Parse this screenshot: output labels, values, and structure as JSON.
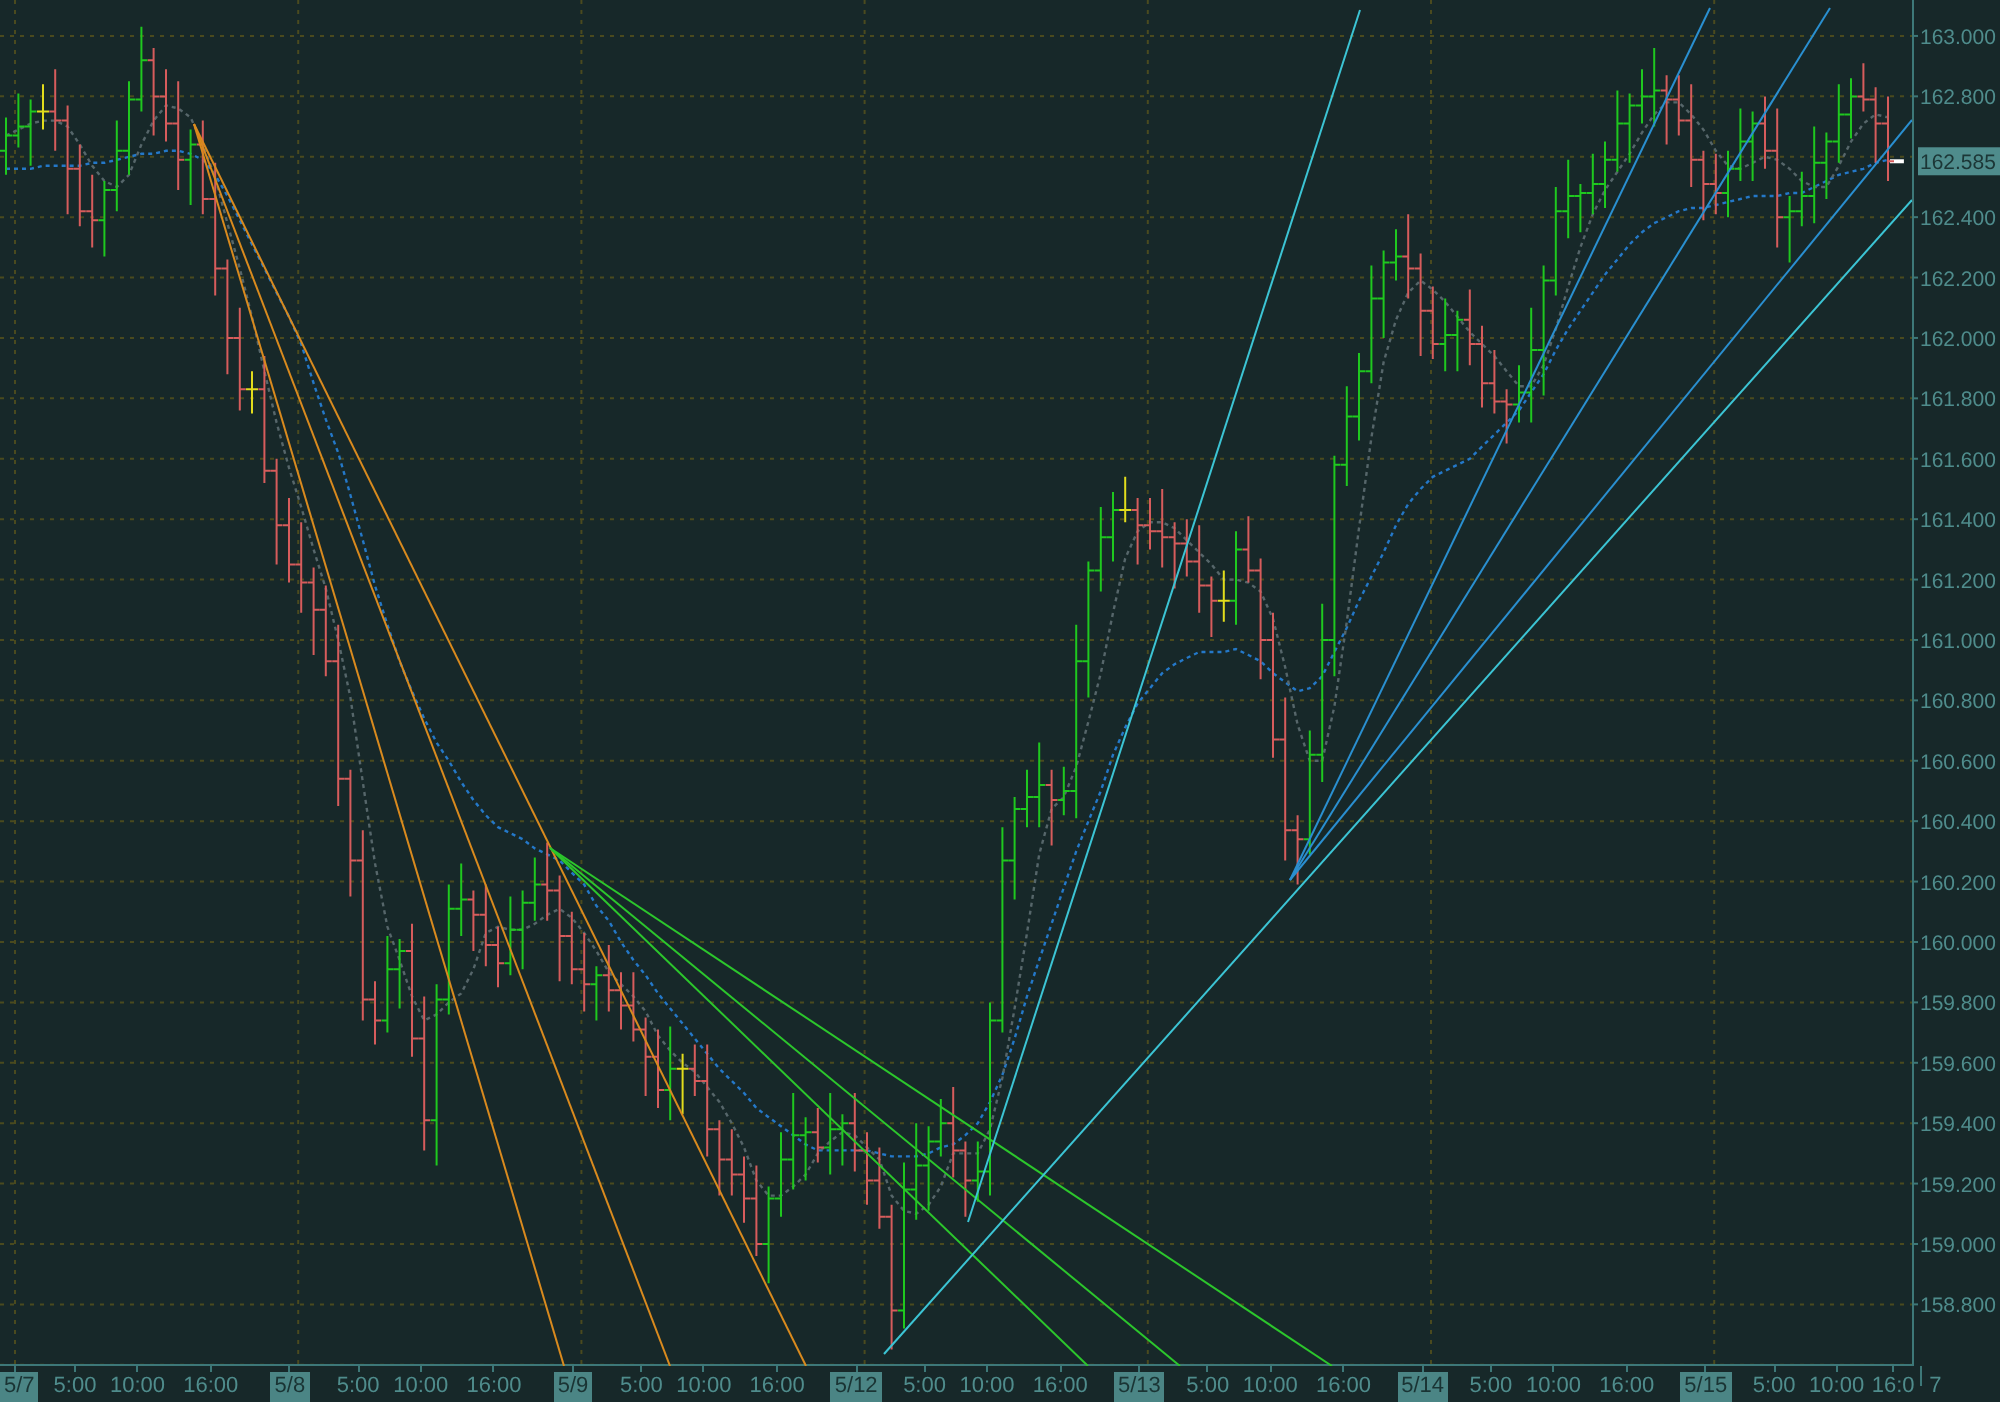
{
  "chart": {
    "chart_data": {
      "type": "line",
      "grid": true,
      "ylim": [
        158.596,
        163.119
      ],
      "yticks": [
        {
          "value": 163.0,
          "label": "163.000"
        },
        {
          "value": 162.8,
          "label": "162.800"
        },
        {
          "value": 162.4,
          "label": "162.400"
        },
        {
          "value": 162.2,
          "label": "162.200"
        },
        {
          "value": 162.0,
          "label": "162.000"
        },
        {
          "value": 161.8,
          "label": "161.800"
        },
        {
          "value": 161.6,
          "label": "161.600"
        },
        {
          "value": 161.4,
          "label": "161.400"
        },
        {
          "value": 161.2,
          "label": "161.200"
        },
        {
          "value": 161.0,
          "label": "161.000"
        },
        {
          "value": 160.8,
          "label": "160.800"
        },
        {
          "value": 160.6,
          "label": "160.600"
        },
        {
          "value": 160.4,
          "label": "160.400"
        },
        {
          "value": 160.2,
          "label": "160.200"
        },
        {
          "value": 160.0,
          "label": "160.000"
        },
        {
          "value": 159.8,
          "label": "159.800"
        },
        {
          "value": 159.6,
          "label": "159.600"
        },
        {
          "value": 159.4,
          "label": "159.400"
        },
        {
          "value": 159.2,
          "label": "159.200"
        },
        {
          "value": 159.0,
          "label": "159.000"
        },
        {
          "value": 158.8,
          "label": "158.800"
        }
      ],
      "series": [
        {
          "color": "#2478c8",
          "line_style": "dashed",
          "values": [
            162.56,
            162.56,
            162.56,
            162.57,
            162.57,
            162.57,
            162.57,
            162.58,
            162.58,
            162.59,
            162.6,
            162.61,
            162.61,
            162.62,
            162.62,
            162.61,
            162.59,
            162.54,
            162.47,
            162.39,
            162.31,
            162.23,
            162.15,
            162.07,
            161.98,
            161.85,
            161.73,
            161.62,
            161.48,
            161.33,
            161.18,
            161.05,
            160.93,
            160.83,
            160.74,
            160.66,
            160.6,
            160.53,
            160.47,
            160.42,
            160.38,
            160.36,
            160.34,
            160.31,
            160.29,
            160.27,
            160.23,
            160.19,
            160.12,
            160.07,
            160.0,
            159.94,
            159.89,
            159.83,
            159.78,
            159.73,
            159.68,
            159.63,
            159.58,
            159.54,
            159.5,
            159.45,
            159.42,
            159.39,
            159.36,
            159.33,
            159.31,
            159.31,
            159.31,
            159.31,
            159.31,
            159.3,
            159.29,
            159.29,
            159.29,
            159.3,
            159.32,
            159.33,
            159.36,
            159.4,
            159.47,
            159.56,
            159.68,
            159.82,
            159.94,
            160.06,
            160.18,
            160.3,
            160.4,
            160.5,
            160.62,
            160.71,
            160.79,
            160.84,
            160.89,
            160.92,
            160.94,
            160.96,
            160.96,
            160.96,
            160.97,
            160.95,
            160.93,
            160.89,
            160.86,
            160.83,
            160.84,
            160.88,
            160.96,
            161.04,
            161.13,
            161.21,
            161.29,
            161.38,
            161.45,
            161.5,
            161.54,
            161.56,
            161.58,
            161.6,
            161.64,
            161.68,
            161.72,
            161.76,
            161.82,
            161.88,
            161.96,
            162.03,
            162.09,
            162.15,
            162.21,
            162.26,
            162.31,
            162.35,
            162.38,
            162.4,
            162.42,
            162.43,
            162.43,
            162.44,
            162.45,
            162.46,
            162.47,
            162.47,
            162.47,
            162.48,
            162.48,
            162.5,
            162.52,
            162.54,
            162.55,
            162.56,
            162.58,
            162.59
          ]
        },
        {
          "color": "#56666a",
          "line_style": "dashed",
          "values": [
            162.67,
            162.69,
            162.71,
            162.72,
            162.72,
            162.7,
            162.64,
            162.57,
            162.52,
            162.5,
            162.54,
            162.64,
            162.72,
            162.77,
            162.76,
            162.73,
            162.64,
            162.53,
            162.38,
            162.23,
            162.07,
            161.89,
            161.72,
            161.57,
            161.44,
            161.3,
            161.17,
            161.0,
            160.81,
            160.53,
            160.26,
            160.05,
            159.94,
            159.82,
            159.74,
            159.76,
            159.8,
            159.83,
            159.91,
            160.03,
            160.05,
            160.04,
            160.04,
            160.06,
            160.09,
            160.11,
            160.08,
            160.03,
            159.97,
            159.9,
            159.86,
            159.82,
            159.77,
            159.69,
            159.64,
            159.6,
            159.57,
            159.52,
            159.47,
            159.4,
            159.32,
            159.21,
            159.16,
            159.16,
            159.19,
            159.23,
            159.3,
            159.34,
            159.37,
            159.36,
            159.32,
            159.28,
            159.16,
            159.11,
            159.1,
            159.13,
            159.19,
            159.3,
            159.3,
            159.3,
            159.38,
            159.55,
            159.78,
            160.03,
            160.29,
            160.44,
            160.48,
            160.58,
            160.73,
            160.89,
            161.09,
            161.27,
            161.36,
            161.39,
            161.39,
            161.37,
            161.33,
            161.29,
            161.25,
            161.2,
            161.2,
            161.19,
            161.16,
            161.07,
            160.91,
            160.72,
            160.6,
            160.6,
            160.78,
            161.06,
            161.37,
            161.67,
            161.92,
            162.06,
            162.15,
            162.19,
            162.16,
            162.12,
            162.07,
            162.02,
            161.98,
            161.94,
            161.89,
            161.84,
            161.84,
            161.91,
            162.03,
            162.17,
            162.3,
            162.41,
            162.49,
            162.55,
            162.61,
            162.68,
            162.74,
            162.78,
            162.78,
            162.74,
            162.69,
            162.62,
            162.57,
            162.56,
            162.58,
            162.6,
            162.59,
            162.56,
            162.52,
            162.5,
            162.5,
            162.57,
            162.65,
            162.71,
            162.74,
            162.73
          ]
        }
      ],
      "annotations": [
        {
          "text": "162.585",
          "y": 162.585
        }
      ]
    }
  },
  "time_axis": {
    "days": [
      {
        "date": "5/7",
        "times": [
          "5:00",
          "10:00",
          "16:00"
        ]
      },
      {
        "date": "5/8",
        "times": [
          "5:00",
          "10:00",
          "16:00"
        ]
      },
      {
        "date": "5/9",
        "times": [
          "5:00",
          "10:00",
          "16:00"
        ]
      },
      {
        "date": "5/12",
        "times": [
          "5:00",
          "10:00",
          "16:00"
        ]
      },
      {
        "date": "5/13",
        "times": [
          "5:00",
          "10:00",
          "16:00"
        ]
      },
      {
        "date": "5/14",
        "times": [
          "5:00",
          "10:00",
          "16:00"
        ]
      },
      {
        "date": "5/15",
        "times": [
          "5:00",
          "10:00",
          "16:0"
        ]
      }
    ],
    "trailing_label": "7"
  }
}
